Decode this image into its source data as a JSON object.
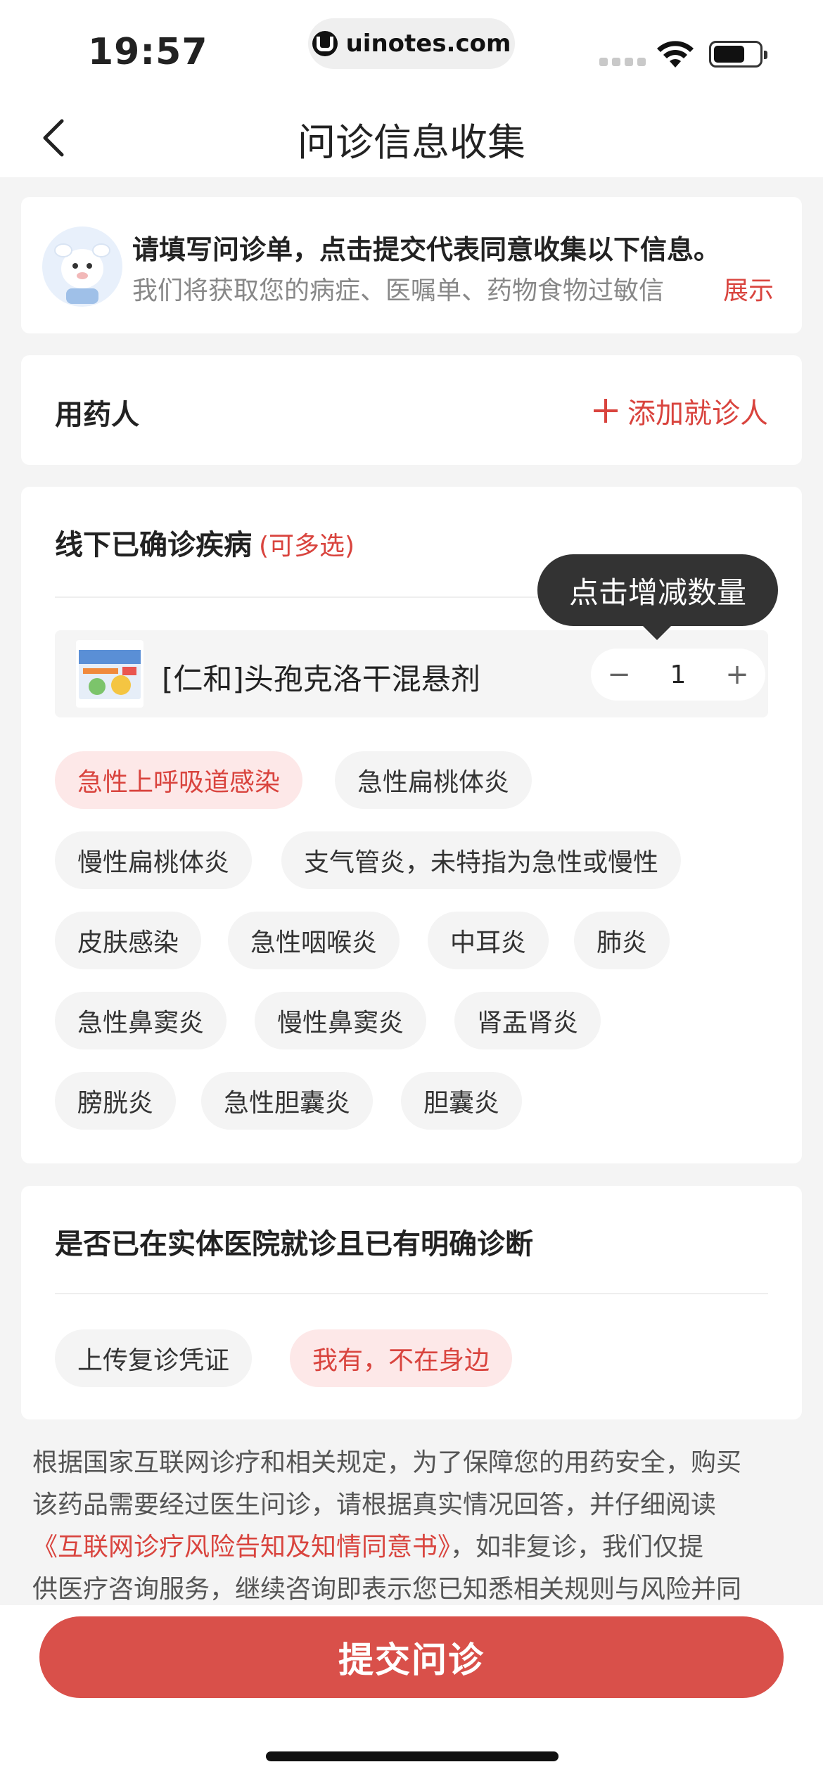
{
  "status_bar": {
    "time": "19:57",
    "url": "uinotes.com"
  },
  "nav": {
    "title": "问诊信息收集"
  },
  "notice": {
    "title": "请填写问诊单，点击提交代表同意收集以下信息。",
    "body": "我们将获取您的病症、医嘱单、药物食物过敏信",
    "expand_label": "展示"
  },
  "patient": {
    "label": "用药人",
    "add_label": "添加就诊人"
  },
  "disease_section": {
    "title": "线下已确诊疾病",
    "hint": "(可多选)",
    "drug": {
      "name": "[仁和]头孢克洛干混悬剂",
      "quantity": "1",
      "minus": "−",
      "plus": "+"
    },
    "tooltip": "点击增减数量",
    "tags": [
      {
        "label": "急性上呼吸道感染",
        "selected": true
      },
      {
        "label": "急性扁桃体炎",
        "selected": false
      },
      {
        "label": "慢性扁桃体炎",
        "selected": false
      },
      {
        "label": "支气管炎，未特指为急性或慢性",
        "selected": false
      },
      {
        "label": "皮肤感染",
        "selected": false
      },
      {
        "label": "急性咽喉炎",
        "selected": false
      },
      {
        "label": "中耳炎",
        "selected": false
      },
      {
        "label": "肺炎",
        "selected": false
      },
      {
        "label": "急性鼻窦炎",
        "selected": false
      },
      {
        "label": "慢性鼻窦炎",
        "selected": false
      },
      {
        "label": "肾盂肾炎",
        "selected": false
      },
      {
        "label": "膀胱炎",
        "selected": false
      },
      {
        "label": "急性胆囊炎",
        "selected": false
      },
      {
        "label": "胆囊炎",
        "selected": false
      }
    ]
  },
  "diagnosis_section": {
    "title": "是否已在实体医院就诊且已有明确诊断",
    "options": [
      {
        "label": "上传复诊凭证",
        "selected": false
      },
      {
        "label": "我有，不在身边",
        "selected": true
      }
    ]
  },
  "legal": {
    "line1": "根据国家互联网诊疗和相关规定，为了保障您的用药安全，购买",
    "line2": "该药品需要经过医生问诊，请根据真实情况回答，并仔细阅读",
    "link": "《互联网诊疗风险告知及知情同意书》",
    "line3_rest": "，如非复诊，我们仅提",
    "line4": "供医疗咨询服务，继续咨询即表示您已知悉相关规则与风险并同"
  },
  "submit": {
    "label": "提交问诊"
  },
  "colors": {
    "accent": "#d9443e",
    "button": "#d9504a",
    "selected_tag_bg": "#fde8e8",
    "tooltip_bg": "#333333"
  }
}
